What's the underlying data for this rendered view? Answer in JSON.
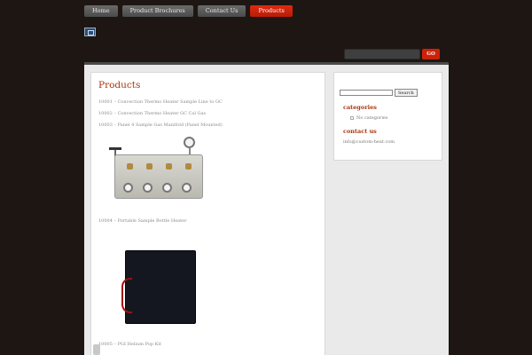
{
  "nav": {
    "items": [
      {
        "label": "Home"
      },
      {
        "label": "Product Brochures"
      },
      {
        "label": "Contact Us"
      },
      {
        "label": "Products"
      }
    ]
  },
  "header": {
    "go_label": "GO"
  },
  "main": {
    "title": "Products",
    "products": [
      {
        "label": "10001 – Convection Thermo Heater Sample Line to GC"
      },
      {
        "label": "10002 – Convection Thermo Heater GC Cal Gas"
      },
      {
        "label": "10003 – Panel 4 Sample Gas Manifold (Panel Mounted)"
      },
      {
        "label": "10004 – Portable Sample Bottle Heater"
      },
      {
        "label": "10005 – PGI Helium Pop Kit"
      }
    ]
  },
  "sidebar": {
    "search_button": "Search",
    "categories_heading": "categories",
    "no_categories": "No categories",
    "contact_heading": "contact us",
    "email": "info@custom-heat.com"
  }
}
